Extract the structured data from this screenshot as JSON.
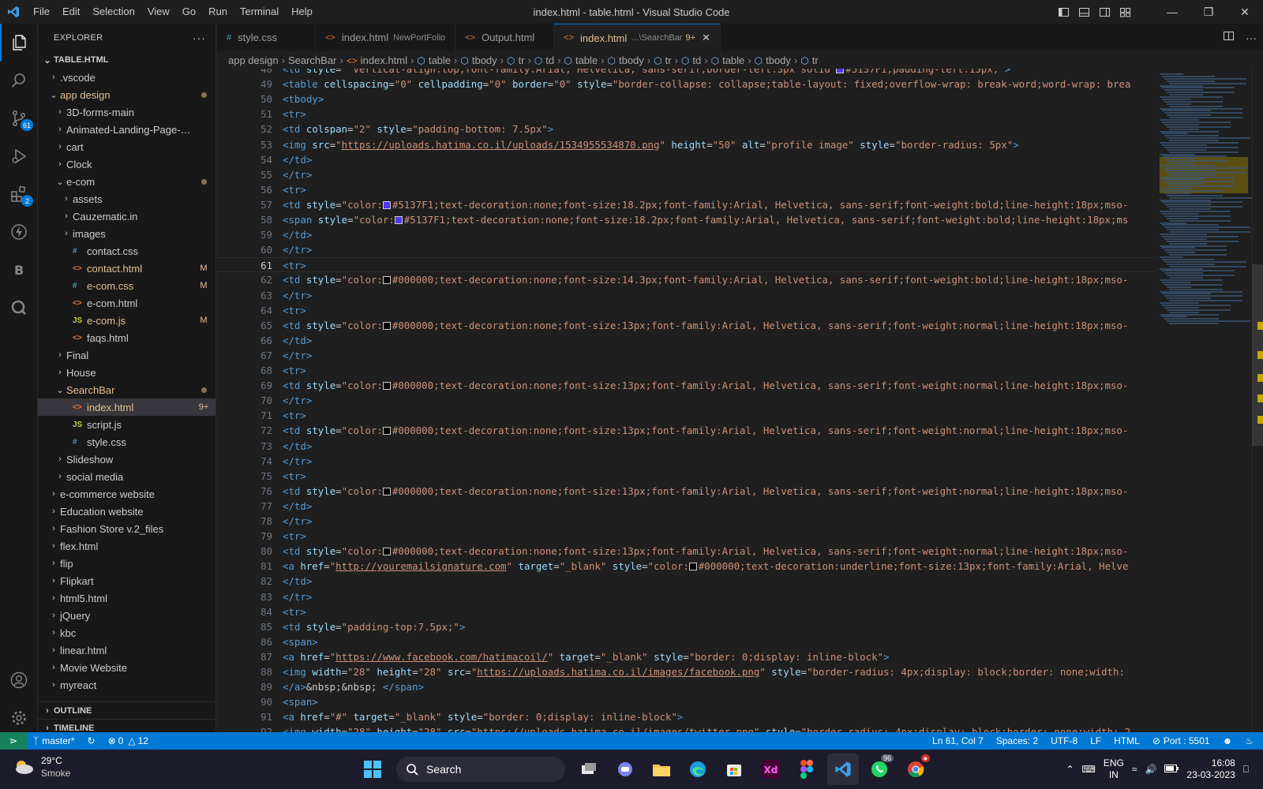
{
  "titlebar": {
    "menus": [
      "File",
      "Edit",
      "Selection",
      "View",
      "Go",
      "Run",
      "Terminal",
      "Help"
    ],
    "title": "index.html - table.html - Visual Studio Code"
  },
  "activity": {
    "scm_badge": "61",
    "extensions_badge": "2"
  },
  "explorer": {
    "header": "EXPLORER",
    "root": "TABLE.HTML",
    "items": [
      {
        "label": ".vscode",
        "depth": 0,
        "type": "folder",
        "open": false
      },
      {
        "label": "app design",
        "depth": 0,
        "type": "folder",
        "open": true,
        "git": true,
        "dot": true
      },
      {
        "label": "3D-forms-main",
        "depth": 1,
        "type": "folder",
        "open": false
      },
      {
        "label": "Animated-Landing-Page-mast...",
        "depth": 1,
        "type": "folder",
        "open": false
      },
      {
        "label": "cart",
        "depth": 1,
        "type": "folder",
        "open": false
      },
      {
        "label": "Clock",
        "depth": 1,
        "type": "folder",
        "open": false
      },
      {
        "label": "e-com",
        "depth": 1,
        "type": "folder",
        "open": true,
        "dot": true
      },
      {
        "label": "assets",
        "depth": 2,
        "type": "folder",
        "open": false
      },
      {
        "label": "Cauzematic.in",
        "depth": 2,
        "type": "folder",
        "open": false
      },
      {
        "label": "images",
        "depth": 2,
        "type": "folder",
        "open": false
      },
      {
        "label": "contact.css",
        "depth": 2,
        "type": "css"
      },
      {
        "label": "contact.html",
        "depth": 2,
        "type": "html",
        "mod": "M"
      },
      {
        "label": "e-com.css",
        "depth": 2,
        "type": "css",
        "mod": "M"
      },
      {
        "label": "e-com.html",
        "depth": 2,
        "type": "html"
      },
      {
        "label": "e-com.js",
        "depth": 2,
        "type": "js",
        "mod": "M"
      },
      {
        "label": "faqs.html",
        "depth": 2,
        "type": "html"
      },
      {
        "label": "Final",
        "depth": 1,
        "type": "folder",
        "open": false
      },
      {
        "label": "House",
        "depth": 1,
        "type": "folder",
        "open": false
      },
      {
        "label": "SearchBar",
        "depth": 1,
        "type": "folder",
        "open": true,
        "git": true,
        "dot": true
      },
      {
        "label": "index.html",
        "depth": 2,
        "type": "html",
        "mod": "9+",
        "selected": true,
        "git": true
      },
      {
        "label": "script.js",
        "depth": 2,
        "type": "js"
      },
      {
        "label": "style.css",
        "depth": 2,
        "type": "css"
      },
      {
        "label": "Slideshow",
        "depth": 1,
        "type": "folder",
        "open": false
      },
      {
        "label": "social media",
        "depth": 1,
        "type": "folder",
        "open": false
      },
      {
        "label": "e-commerce website",
        "depth": 0,
        "type": "folder",
        "open": false
      },
      {
        "label": "Education website",
        "depth": 0,
        "type": "folder",
        "open": false
      },
      {
        "label": "Fashion Store v.2_files",
        "depth": 0,
        "type": "folder",
        "open": false
      },
      {
        "label": "flex.html",
        "depth": 0,
        "type": "folder",
        "open": false
      },
      {
        "label": "flip",
        "depth": 0,
        "type": "folder",
        "open": false
      },
      {
        "label": "Flipkart",
        "depth": 0,
        "type": "folder",
        "open": false
      },
      {
        "label": "html5.html",
        "depth": 0,
        "type": "folder",
        "open": false
      },
      {
        "label": "jQuery",
        "depth": 0,
        "type": "folder",
        "open": false
      },
      {
        "label": "kbc",
        "depth": 0,
        "type": "folder",
        "open": false
      },
      {
        "label": "linear.html",
        "depth": 0,
        "type": "folder",
        "open": false
      },
      {
        "label": "Movie Website",
        "depth": 0,
        "type": "folder",
        "open": false
      },
      {
        "label": "myreact",
        "depth": 0,
        "type": "folder",
        "open": false
      }
    ],
    "outline": "OUTLINE",
    "timeline": "TIMELINE"
  },
  "tabs": [
    {
      "label": "style.css",
      "icon": "#",
      "active": false
    },
    {
      "label": "index.html",
      "desc": "NewPortFolio",
      "icon": "<>",
      "active": false
    },
    {
      "label": "Output.html",
      "icon": "<>",
      "active": false
    },
    {
      "label": "index.html",
      "desc": "...\\SearchBar",
      "count": "9+",
      "icon": "<>",
      "active": true
    }
  ],
  "breadcrumb": [
    "app design",
    "SearchBar",
    "index.html",
    "table",
    "tbody",
    "tr",
    "td",
    "table",
    "tbody",
    "tr",
    "td",
    "table",
    "tbody",
    "tr"
  ],
  "code": {
    "current_line": 61,
    "lines": [
      {
        "n": "48",
        "h": "<span class=\"t\">&lt;td</span> <span class=\"a\">style</span>=<span class=\"s\">\" vertical-align:top;font-family:Arial, Helvetica, sans-serif;border-left:3px solid <i class=\"sw\" style=\"background:#5137F1\"></i>#5137F1;padding-left:15px;\"</span><span class=\"t\">&gt;</span>"
      },
      {
        "n": "49",
        "h": "<span class=\"t\">&lt;table</span> <span class=\"a\">cellspacing</span>=<span class=\"s\">\"0\"</span> <span class=\"a\">cellpadding</span>=<span class=\"s\">\"0\"</span> <span class=\"a\">border</span>=<span class=\"s\">\"0\"</span> <span class=\"a\">style</span>=<span class=\"s\">\"border-collapse: collapse;table-layout: fixed;overflow-wrap: break-word;word-wrap: brea</span>"
      },
      {
        "n": "50",
        "h": "<span class=\"t\">&lt;tbody&gt;</span>"
      },
      {
        "n": "51",
        "h": "<span class=\"t\">&lt;tr&gt;</span>"
      },
      {
        "n": "52",
        "h": "<span class=\"t\">&lt;td</span> <span class=\"a\">colspan</span>=<span class=\"s\">\"2\"</span> <span class=\"a\">style</span>=<span class=\"s\">\"padding-bottom: 7.5px\"</span><span class=\"t\">&gt;</span>"
      },
      {
        "n": "53",
        "h": "<span class=\"t\">&lt;img</span> <span class=\"a\">src</span>=<span class=\"s\">\"<span class=\"u\">https://uploads.hatima.co.il/uploads/1534955534870.png</span>\"</span> <span class=\"a\">height</span>=<span class=\"s\">\"50\"</span> <span class=\"a\">alt</span>=<span class=\"s\">\"profile image\"</span> <span class=\"a\">style</span>=<span class=\"s\">\"border-radius: 5px\"</span><span class=\"t\">&gt;</span>"
      },
      {
        "n": "54",
        "h": "<span class=\"t\">&lt;/td&gt;</span>"
      },
      {
        "n": "55",
        "h": "<span class=\"t\">&lt;/tr&gt;</span>"
      },
      {
        "n": "56",
        "h": "<span class=\"t\">&lt;tr&gt;</span>"
      },
      {
        "n": "57",
        "h": "<span class=\"t\">&lt;td</span> <span class=\"a\">style</span>=<span class=\"s\">\"color:<i class=\"sw\" style=\"background:#5137F1\"></i>#5137F1;text-decoration:none;font-size:18.2px;font-family:Arial, Helvetica, sans-serif;font-weight:bold;line-height:18px;mso-</span>"
      },
      {
        "n": "58",
        "h": "<span class=\"t\">&lt;span</span> <span class=\"a\">style</span>=<span class=\"s\">\"color:<i class=\"sw\" style=\"background:#5137F1\"></i>#5137F1;text-decoration:none;font-size:18.2px;font-family:Arial, Helvetica, sans-serif;font-weight:bold;line-height:18px;ms</span>"
      },
      {
        "n": "59",
        "h": "<span class=\"t\">&lt;/td&gt;</span>"
      },
      {
        "n": "60",
        "h": "<span class=\"t\">&lt;/tr&gt;</span>"
      },
      {
        "n": "61",
        "h": "<span class=\"t\">&lt;tr&gt;</span>"
      },
      {
        "n": "62",
        "h": "<span class=\"t\">&lt;td</span> <span class=\"a\">style</span>=<span class=\"s\">\"color:<i class=\"sw\" style=\"background:#000000\"></i>#000000;text-decoration:none;font-size:14.3px;font-family:Arial, Helvetica, sans-serif;font-weight:bold;line-height:18px;mso-</span>"
      },
      {
        "n": "63",
        "h": "<span class=\"t\">&lt;/tr&gt;</span>"
      },
      {
        "n": "64",
        "h": "<span class=\"t\">&lt;tr&gt;</span>"
      },
      {
        "n": "65",
        "h": "<span class=\"t\">&lt;td</span> <span class=\"a\">style</span>=<span class=\"s\">\"color:<i class=\"sw\" style=\"background:#000000\"></i>#000000;text-decoration:none;font-size:13px;font-family:Arial, Helvetica, sans-serif;font-weight:normal;line-height:18px;mso-</span>"
      },
      {
        "n": "66",
        "h": "<span class=\"t\">&lt;/td&gt;</span>"
      },
      {
        "n": "67",
        "h": "<span class=\"t\">&lt;/tr&gt;</span>"
      },
      {
        "n": "68",
        "h": "<span class=\"t\">&lt;tr&gt;</span>"
      },
      {
        "n": "69",
        "h": "<span class=\"t\">&lt;td</span> <span class=\"a\">style</span>=<span class=\"s\">\"color:<i class=\"sw\" style=\"background:#000000\"></i>#000000;text-decoration:none;font-size:13px;font-family:Arial, Helvetica, sans-serif;font-weight:normal;line-height:18px;mso-</span>"
      },
      {
        "n": "70",
        "h": "<span class=\"t\">&lt;/tr&gt;</span>"
      },
      {
        "n": "71",
        "h": "<span class=\"t\">&lt;tr&gt;</span>"
      },
      {
        "n": "72",
        "h": "<span class=\"t\">&lt;td</span> <span class=\"a\">style</span>=<span class=\"s\">\"color:<i class=\"sw\" style=\"background:#000000\"></i>#000000;text-decoration:none;font-size:13px;font-family:Arial, Helvetica, sans-serif;font-weight:normal;line-height:18px;mso-</span>"
      },
      {
        "n": "73",
        "h": "<span class=\"t\">&lt;/td&gt;</span>"
      },
      {
        "n": "74",
        "h": "<span class=\"t\">&lt;/tr&gt;</span>"
      },
      {
        "n": "75",
        "h": "<span class=\"t\">&lt;tr&gt;</span>"
      },
      {
        "n": "76",
        "h": "<span class=\"t\">&lt;td</span> <span class=\"a\">style</span>=<span class=\"s\">\"color:<i class=\"sw\" style=\"background:#000000\"></i>#000000;text-decoration:none;font-size:13px;font-family:Arial, Helvetica, sans-serif;font-weight:normal;line-height:18px;mso-</span>"
      },
      {
        "n": "77",
        "h": "<span class=\"t\">&lt;/td&gt;</span>"
      },
      {
        "n": "78",
        "h": "<span class=\"t\">&lt;/tr&gt;</span>"
      },
      {
        "n": "79",
        "h": "<span class=\"t\">&lt;tr&gt;</span>"
      },
      {
        "n": "80",
        "h": "<span class=\"t\">&lt;td</span> <span class=\"a\">style</span>=<span class=\"s\">\"color:<i class=\"sw\" style=\"background:#000000\"></i>#000000;text-decoration:none;font-size:13px;font-family:Arial, Helvetica, sans-serif;font-weight:normal;line-height:18px;mso-</span>"
      },
      {
        "n": "81",
        "h": "<span class=\"t\">&lt;a</span> <span class=\"a\">href</span>=<span class=\"s\">\"<span class=\"u\">http://youremailsignature.com</span>\"</span> <span class=\"a\">target</span>=<span class=\"s\">\"_blank\"</span> <span class=\"a\">style</span>=<span class=\"s\">\"color:<i class=\"sw\" style=\"background:#000000\"></i>#000000;text-decoration:underline;font-size:13px;font-family:Arial, Helve</span>"
      },
      {
        "n": "82",
        "h": "<span class=\"t\">&lt;/td&gt;</span>"
      },
      {
        "n": "83",
        "h": "<span class=\"t\">&lt;/tr&gt;</span>"
      },
      {
        "n": "84",
        "h": "<span class=\"t\">&lt;tr&gt;</span>"
      },
      {
        "n": "85",
        "h": "<span class=\"t\">&lt;td</span> <span class=\"a\">style</span>=<span class=\"s\">\"padding-top:7.5px;\"</span><span class=\"t\">&gt;</span>"
      },
      {
        "n": "86",
        "h": "<span class=\"t\">&lt;span&gt;</span>"
      },
      {
        "n": "87",
        "h": "<span class=\"t\">&lt;a</span> <span class=\"a\">href</span>=<span class=\"s\">\"<span class=\"u\">https://www.facebook.com/hatimacoil/</span>\"</span> <span class=\"a\">target</span>=<span class=\"s\">\"_blank\"</span> <span class=\"a\">style</span>=<span class=\"s\">\"border: 0;display: inline-block\"</span><span class=\"t\">&gt;</span>"
      },
      {
        "n": "88",
        "h": "<span class=\"t\">&lt;img</span> <span class=\"a\">width</span>=<span class=\"s\">\"28\"</span> <span class=\"a\">height</span>=<span class=\"s\">\"28\"</span> <span class=\"a\">src</span>=<span class=\"s\">\"<span class=\"u\">https://uploads.hatima.co.il/images/facebook.png</span>\"</span> <span class=\"a\">style</span>=<span class=\"s\">\"border-radius: 4px;display: block;border: none;width:</span>"
      },
      {
        "n": "89",
        "h": "<span class=\"t\">&lt;/a&gt;</span>&amp;nbsp;&amp;nbsp; <span class=\"t\">&lt;/span&gt;</span>"
      },
      {
        "n": "90",
        "h": "<span class=\"t\">&lt;span&gt;</span>"
      },
      {
        "n": "91",
        "h": "<span class=\"t\">&lt;a</span> <span class=\"a\">href</span>=<span class=\"s\">\"#\"</span> <span class=\"a\">target</span>=<span class=\"s\">\"_blank\"</span> <span class=\"a\">style</span>=<span class=\"s\">\"border: 0;display: inline-block\"</span><span class=\"t\">&gt;</span>"
      },
      {
        "n": "92",
        "h": "<span class=\"t\">&lt;img</span> <span class=\"a\">width</span>=<span class=\"s\">\"28\"</span> <span class=\"a\">height</span>=<span class=\"s\">\"28\"</span> <span class=\"a\">src</span>=<span class=\"s\">\"<span class=\"u\">https://uploads.hatima.co.il/images/twitter.png</span>\"</span> <span class=\"a\">style</span>=<span class=\"s\">\"border-radius: 4px;display: block;border: none;width: 2</span>"
      }
    ]
  },
  "status": {
    "branch": "master*",
    "errors": "0",
    "warnings": "12",
    "position": "Ln 61, Col 7",
    "spaces": "Spaces: 2",
    "encoding": "UTF-8",
    "eol": "LF",
    "language": "HTML",
    "port": "Port : 5501"
  },
  "taskbar": {
    "temperature": "29°C",
    "weather": "Smoke",
    "search": "Search",
    "whatsapp_badge": "96",
    "lang_top": "ENG",
    "lang_bottom": "IN",
    "time": "16:08",
    "date": "23-03-2023"
  }
}
